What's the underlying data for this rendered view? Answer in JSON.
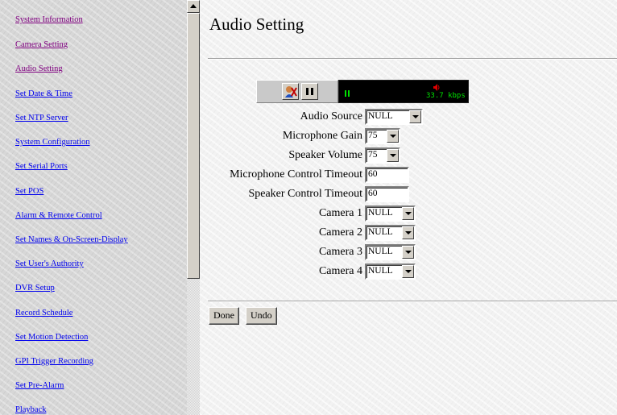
{
  "nav": {
    "items": [
      {
        "label": "System Information",
        "visited": true
      },
      {
        "label": "Camera Setting",
        "visited": true
      },
      {
        "label": "Audio Setting",
        "visited": true
      },
      {
        "label": "Set Date & Time",
        "visited": false
      },
      {
        "label": "Set NTP Server",
        "visited": false
      },
      {
        "label": "System Configuration",
        "visited": false
      },
      {
        "label": "Set Serial Ports",
        "visited": false
      },
      {
        "label": "Set POS",
        "visited": false
      },
      {
        "label": "Alarm & Remote Control",
        "visited": false
      },
      {
        "label": "Set Names & On-Screen-Display",
        "visited": false
      },
      {
        "label": "Set User's Authority",
        "visited": false
      },
      {
        "label": "DVR Setup",
        "visited": false
      },
      {
        "label": "Record Schedule",
        "visited": false
      },
      {
        "label": "Set Motion Detection",
        "visited": false
      },
      {
        "label": "GPI Trigger Recording",
        "visited": false
      },
      {
        "label": "Set Pre-Alarm",
        "visited": false
      },
      {
        "label": "Playback",
        "visited": false
      }
    ]
  },
  "page": {
    "title": "Audio Setting"
  },
  "player": {
    "bitrate": "33.7 kbps",
    "icons": [
      "talk-icon",
      "pause-icon",
      "level-meter-icon",
      "speaker-icon"
    ]
  },
  "form": {
    "audio_source": {
      "label": "Audio Source",
      "value": "NULL"
    },
    "microphone_gain": {
      "label": "Microphone Gain",
      "value": "75"
    },
    "speaker_volume": {
      "label": "Speaker Volume",
      "value": "75"
    },
    "microphone_timeout": {
      "label": "Microphone Control Timeout",
      "value": "60"
    },
    "speaker_timeout": {
      "label": "Speaker Control Timeout",
      "value": "60"
    },
    "camera1": {
      "label": "Camera 1",
      "value": "NULL"
    },
    "camera2": {
      "label": "Camera 2",
      "value": "NULL"
    },
    "camera3": {
      "label": "Camera 3",
      "value": "NULL"
    },
    "camera4": {
      "label": "Camera 4",
      "value": "NULL"
    }
  },
  "buttons": {
    "done": "Done",
    "undo": "Undo"
  },
  "colors": {
    "link_visited": "#800080",
    "link_unvisited": "#0000ee",
    "meter_green": "#00e000",
    "speaker_red": "#e00000"
  }
}
